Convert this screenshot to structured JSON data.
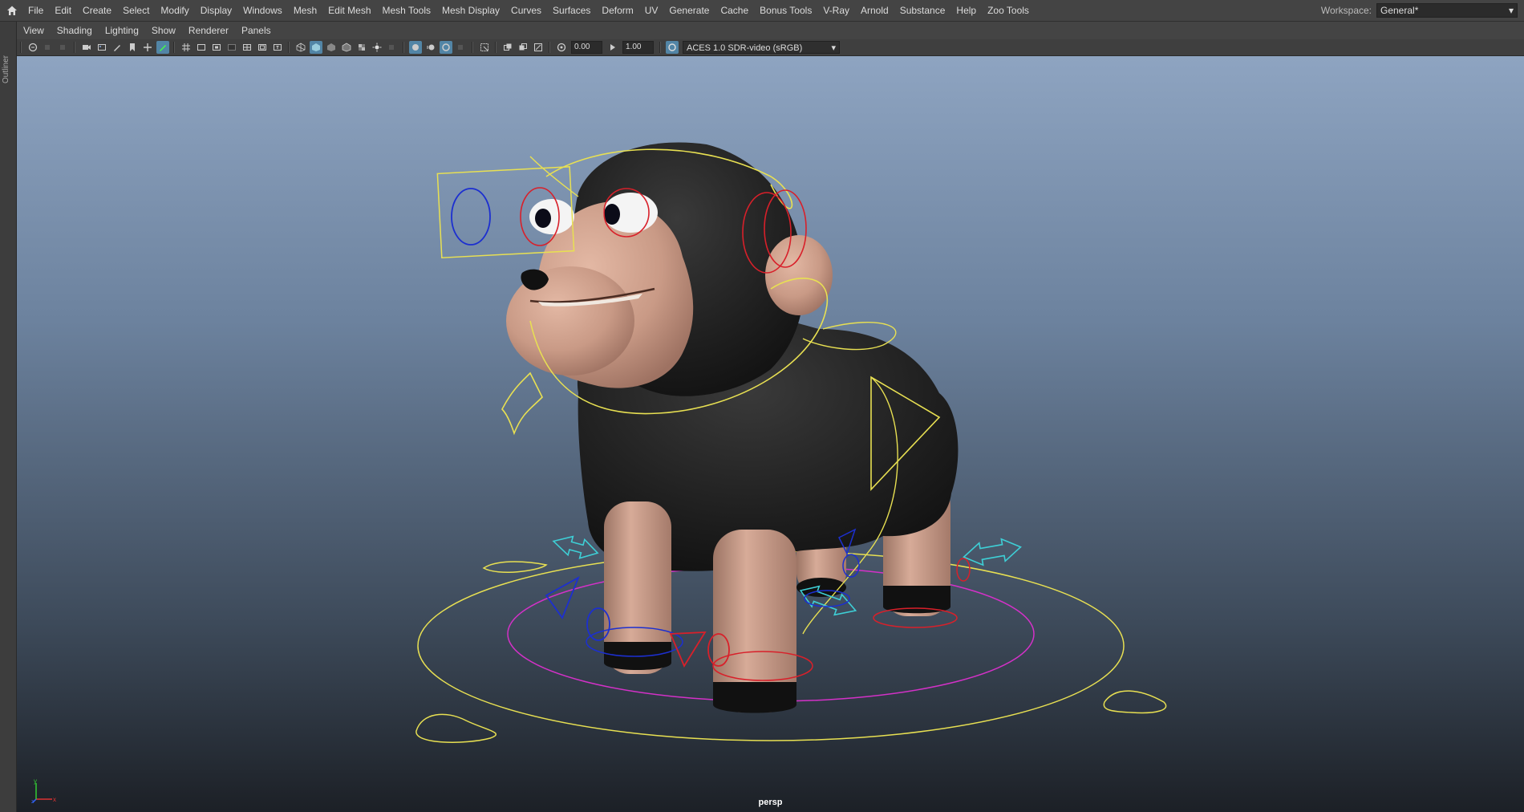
{
  "menubar": {
    "items": [
      "File",
      "Edit",
      "Create",
      "Select",
      "Modify",
      "Display",
      "Windows",
      "Mesh",
      "Edit Mesh",
      "Mesh Tools",
      "Mesh Display",
      "Curves",
      "Surfaces",
      "Deform",
      "UV",
      "Generate",
      "Cache",
      "Bonus Tools",
      "V-Ray",
      "Arnold",
      "Substance",
      "Help",
      "Zoo Tools"
    ],
    "workspace_label": "Workspace:",
    "workspace_value": "General*"
  },
  "left_panel": {
    "outliner_tab": "Outliner"
  },
  "panel_menu": {
    "items": [
      "View",
      "Shading",
      "Lighting",
      "Show",
      "Renderer",
      "Panels"
    ]
  },
  "toolbar": {
    "exposure_value": "0.00",
    "gamma_value": "1.00",
    "color_space": "ACES 1.0 SDR-video (sRGB)"
  },
  "viewport": {
    "camera_label": "persp",
    "axis_labels": {
      "x": "x",
      "y": "y",
      "z": "z"
    }
  },
  "colors": {
    "rig_yellow": "#e8e052",
    "rig_magenta": "#d431c8",
    "rig_red": "#d8202a",
    "rig_blue": "#1c2fd0",
    "rig_cyan": "#3ecfd6",
    "wool": "#1e1e1e",
    "skin": "#c99a86"
  }
}
